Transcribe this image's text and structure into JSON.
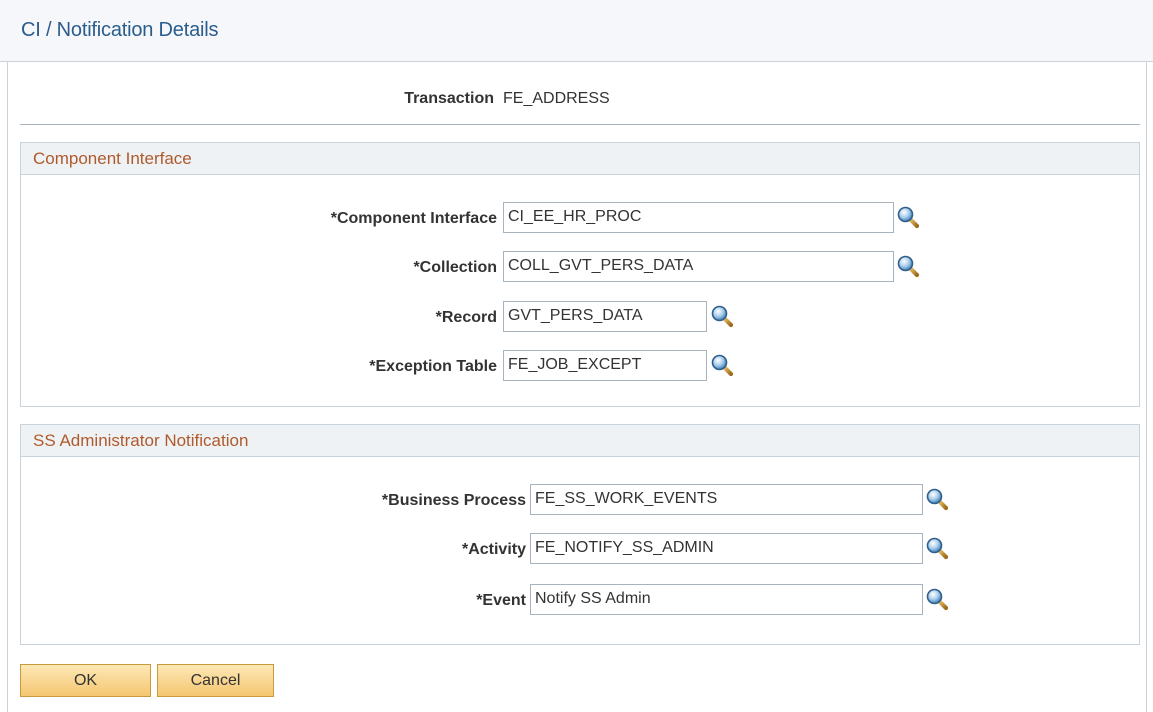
{
  "page": {
    "title": "CI / Notification Details"
  },
  "transaction": {
    "label": "Transaction",
    "value": "FE_ADDRESS"
  },
  "component_interface": {
    "header": "Component Interface",
    "fields": [
      {
        "label": "*Component Interface",
        "value": "CI_EE_HR_PROC"
      },
      {
        "label": "*Collection",
        "value": "COLL_GVT_PERS_DATA"
      },
      {
        "label": "*Record",
        "value": "GVT_PERS_DATA"
      },
      {
        "label": "*Exception Table",
        "value": "FE_JOB_EXCEPT"
      }
    ]
  },
  "ss_admin": {
    "header": "SS Administrator Notification",
    "fields": [
      {
        "label": "*Business Process",
        "value": "FE_SS_WORK_EVENTS"
      },
      {
        "label": "*Activity",
        "value": "FE_NOTIFY_SS_ADMIN"
      },
      {
        "label": "*Event",
        "value": "Notify SS Admin"
      }
    ]
  },
  "buttons": {
    "ok": "OK",
    "cancel": "Cancel"
  },
  "icons": {
    "lookup": "lookup-magnifier-icon"
  },
  "colors": {
    "title": "#2b5d8c",
    "group_header_text": "#b05a2c",
    "button_top": "#fde8b6",
    "button_bottom": "#f5c670"
  }
}
